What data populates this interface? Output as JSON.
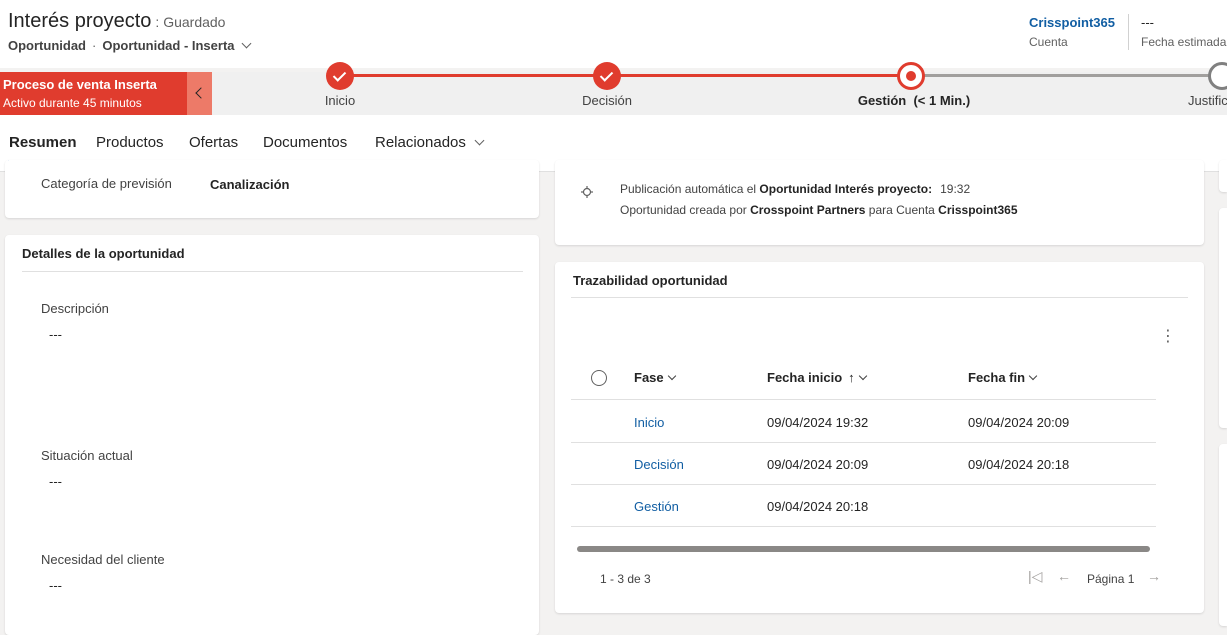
{
  "header": {
    "title": "Interés proyecto",
    "save_status": ": Guardado",
    "entity": "Oportunidad",
    "form": "Oportunidad - Inserta",
    "account_value": "Crisspoint365",
    "account_label": "Cuenta",
    "close_value": "---",
    "close_label": "Fecha estimada d"
  },
  "bpf": {
    "process_name": "Proceso de venta Inserta",
    "active_for": "Activo durante 45 minutos",
    "stages": [
      {
        "label": "Inicio",
        "state": "done"
      },
      {
        "label": "Decisión",
        "state": "done"
      },
      {
        "label": "Gestión  (< 1 Min.)",
        "state": "active"
      },
      {
        "label": "Justific",
        "state": "next"
      }
    ]
  },
  "tabs": [
    "Resumen",
    "Productos",
    "Ofertas",
    "Documentos",
    "Relacionados"
  ],
  "summary": {
    "forecast_label": "Categoría de previsión",
    "forecast_value": "Canalización"
  },
  "details": {
    "title": "Detalles de la oportunidad",
    "fields": [
      {
        "label": "Descripción",
        "value": "---"
      },
      {
        "label": "Situación actual",
        "value": "---"
      },
      {
        "label": "Necesidad del cliente",
        "value": "---"
      }
    ]
  },
  "timeline": {
    "line1_prefix": "Publicación automática el ",
    "line1_bold": "Oportunidad Interés proyecto:",
    "line1_time": "19:32",
    "line2_prefix": "Oportunidad creada por ",
    "line2_bold_user": "Crosspoint Partners",
    "line2_mid": " para Cuenta ",
    "line2_bold_account": "Crisspoint365"
  },
  "trace": {
    "title": "Trazabilidad oportunidad",
    "columns": [
      "Fase",
      "Fecha inicio",
      "Fecha fin"
    ],
    "rows": [
      {
        "fase": "Inicio",
        "inicio": "09/04/2024 19:32",
        "fin": "09/04/2024 20:09"
      },
      {
        "fase": "Decisión",
        "inicio": "09/04/2024 20:09",
        "fin": "09/04/2024 20:18"
      },
      {
        "fase": "Gestión",
        "inicio": "09/04/2024 20:18",
        "fin": ""
      }
    ],
    "record_count": "1 - 3 de 3",
    "page_label": "Página 1"
  }
}
